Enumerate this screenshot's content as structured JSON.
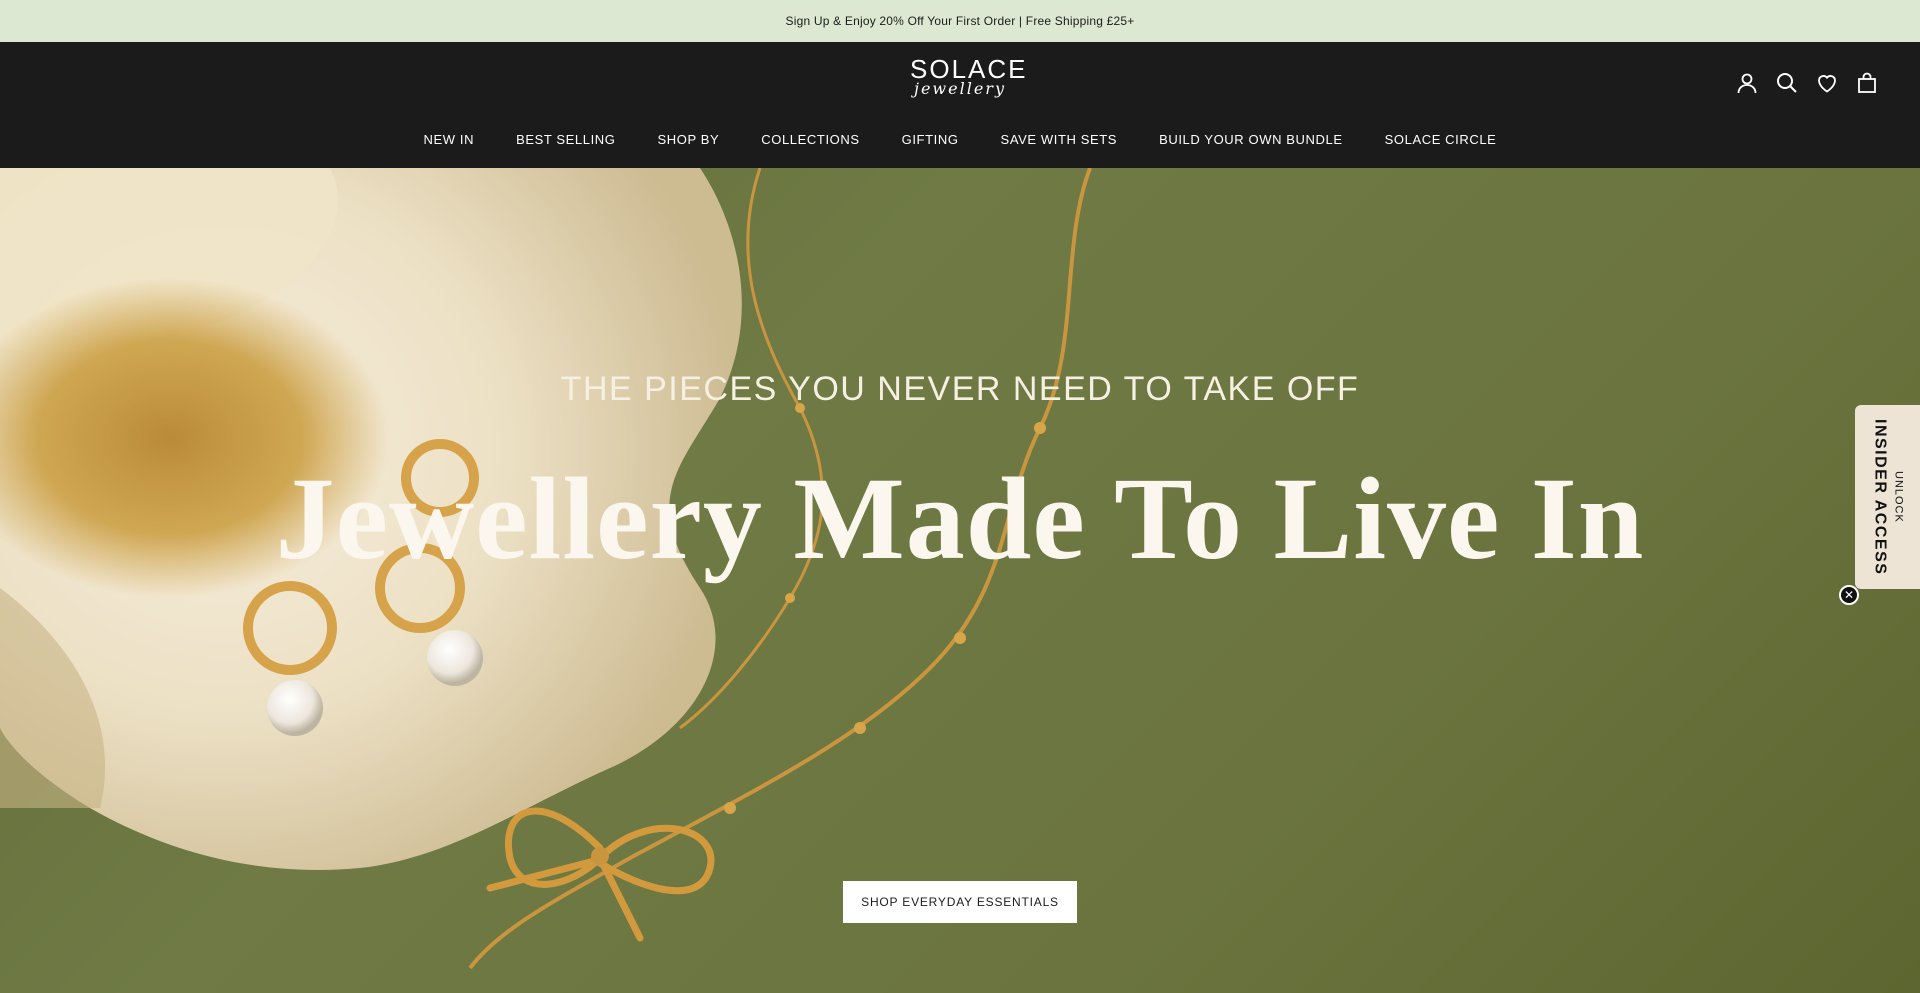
{
  "announcement": {
    "text": "Sign Up & Enjoy 20% Off Your First Order | Free Shipping £25+"
  },
  "header": {
    "logo_main": "SOLACE",
    "logo_script": "jewellery",
    "icons": [
      "account-icon",
      "search-icon",
      "wishlist-icon",
      "bag-icon"
    ]
  },
  "nav": {
    "items": [
      {
        "label": "NEW IN"
      },
      {
        "label": "BEST SELLING"
      },
      {
        "label": "SHOP BY"
      },
      {
        "label": "COLLECTIONS"
      },
      {
        "label": "GIFTING"
      },
      {
        "label": "SAVE WITH SETS"
      },
      {
        "label": "BUILD YOUR OWN BUNDLE"
      },
      {
        "label": "SOLACE CIRCLE"
      }
    ]
  },
  "hero": {
    "kicker": "THE PIECES YOU NEVER NEED TO TAKE OFF",
    "title": "Jewellery Made To Live In",
    "cta_label": "SHOP EVERYDAY ESSENTIALS"
  },
  "insider_tab": {
    "main_label": "INSIDER ACCESS",
    "small_label": "UNLOCK",
    "close_icon": "close-icon"
  },
  "colors": {
    "announcement_bg": "#dde8d2",
    "header_bg": "#1b1b1b",
    "hero_bg": "#6b743e",
    "tab_bg": "#ede4d6",
    "gold": "#c9953f"
  }
}
